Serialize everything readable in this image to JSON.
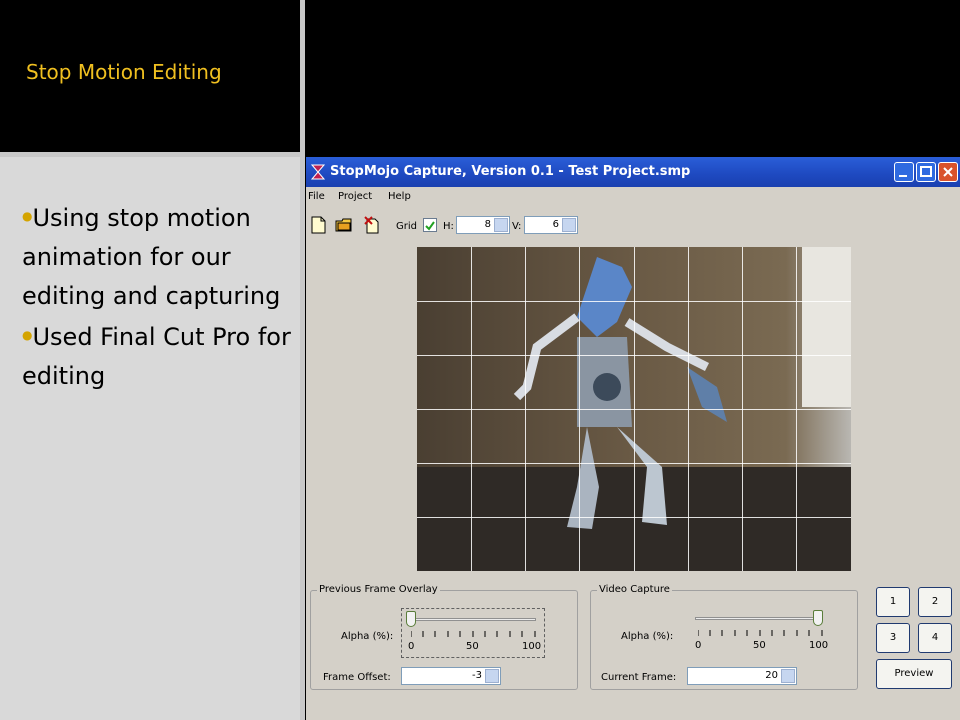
{
  "slide": {
    "title": "Stop Motion Editing",
    "bullets": [
      "Using stop motion animation for our  editing and capturing",
      "Used Final Cut Pro for editing"
    ]
  },
  "app": {
    "window_title": "StopMojo Capture, Version 0.1 - Test Project.smp",
    "menu": [
      "File",
      "Project",
      "Help"
    ],
    "toolbar": {
      "icons": [
        "new-project-icon",
        "open-project-icon",
        "delete-icon"
      ],
      "grid_label": "Grid",
      "grid_checked": true,
      "h_label": "H:",
      "h_value": "8",
      "v_label": "V:",
      "v_value": "6"
    },
    "grid": {
      "columns": 8,
      "rows": 6
    },
    "overlay": {
      "title": "Previous Frame Overlay",
      "alpha_label": "Alpha (%):",
      "alpha_value": 0,
      "tick_labels": [
        "0",
        "50",
        "100"
      ],
      "frame_offset_label": "Frame Offset:",
      "frame_offset_value": "-3"
    },
    "capture": {
      "title": "Video Capture",
      "alpha_label": "Alpha (%):",
      "alpha_value": 100,
      "tick_labels": [
        "0",
        "50",
        "100"
      ],
      "current_frame_label": "Current Frame:",
      "current_frame_value": "20"
    },
    "buttons": [
      "1",
      "2",
      "3",
      "4"
    ],
    "preview_label": "Preview"
  },
  "colors": {
    "title": "#f0c020",
    "bullet": "#d4a400",
    "titlebar": "#1e49c0"
  }
}
